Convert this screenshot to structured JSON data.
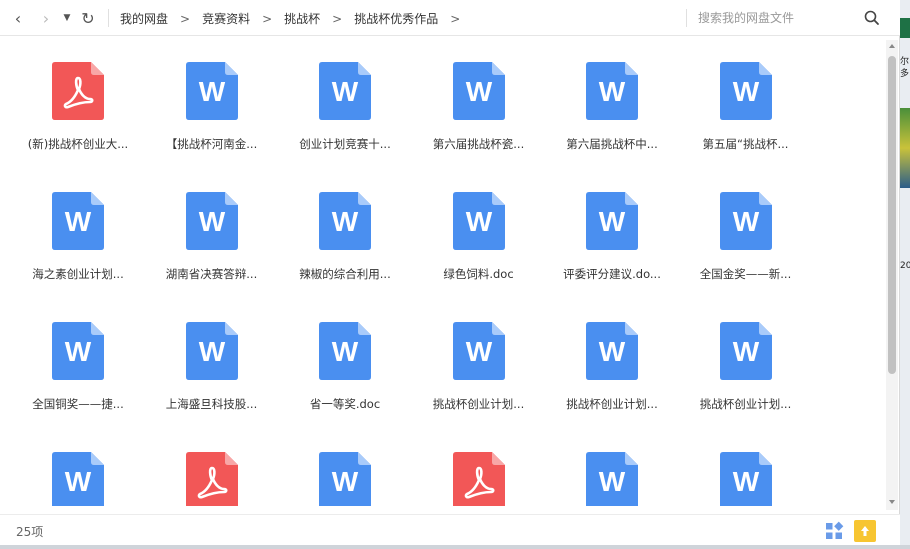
{
  "toolbar": {
    "back_icon": "‹",
    "forward_icon": "›",
    "dropdown_icon": "▼",
    "refresh_icon": "↻",
    "breadcrumb": [
      "我的网盘",
      "竞赛资料",
      "挑战杯",
      "挑战杯优秀作品"
    ],
    "crumb_separator": ">",
    "search_placeholder": "搜索我的网盘文件"
  },
  "files": [
    {
      "name": "(新)挑战杯创业大...",
      "type": "pdf"
    },
    {
      "name": "【挑战杯河南金...",
      "type": "word"
    },
    {
      "name": "创业计划竞赛十...",
      "type": "word"
    },
    {
      "name": "第六届挑战杯瓷...",
      "type": "word"
    },
    {
      "name": "第六届挑战杯中...",
      "type": "word"
    },
    {
      "name": "第五届“挑战杯...",
      "type": "word"
    },
    {
      "name": "海之素创业计划...",
      "type": "word"
    },
    {
      "name": "湖南省决赛答辩...",
      "type": "word"
    },
    {
      "name": "辣椒的综合利用...",
      "type": "word"
    },
    {
      "name": "绿色饲料.doc",
      "type": "word"
    },
    {
      "name": "评委评分建议.do...",
      "type": "word"
    },
    {
      "name": "全国金奖——新...",
      "type": "word"
    },
    {
      "name": "全国铜奖——捷...",
      "type": "word"
    },
    {
      "name": "上海盛旦科技股...",
      "type": "word"
    },
    {
      "name": "省一等奖.doc",
      "type": "word"
    },
    {
      "name": "挑战杯创业计划...",
      "type": "word"
    },
    {
      "name": "挑战杯创业计划...",
      "type": "word"
    },
    {
      "name": "挑战杯创业计划...",
      "type": "word"
    },
    {
      "name": "",
      "type": "word"
    },
    {
      "name": "",
      "type": "pdf"
    },
    {
      "name": "",
      "type": "word"
    },
    {
      "name": "",
      "type": "pdf"
    },
    {
      "name": "",
      "type": "word"
    },
    {
      "name": "",
      "type": "word"
    }
  ],
  "icons": {
    "word_letter": "W",
    "word_color": "#4a8ff0",
    "word_fold": "#a9cbfa",
    "pdf_color": "#f25757",
    "pdf_fold": "#f8a7a7"
  },
  "status": {
    "item_count": "25项"
  },
  "desktop_strip": {
    "text": "尔\n多\n\n\n\n\n\n\n\n\n\n\n\n\n\n\n\n20"
  }
}
